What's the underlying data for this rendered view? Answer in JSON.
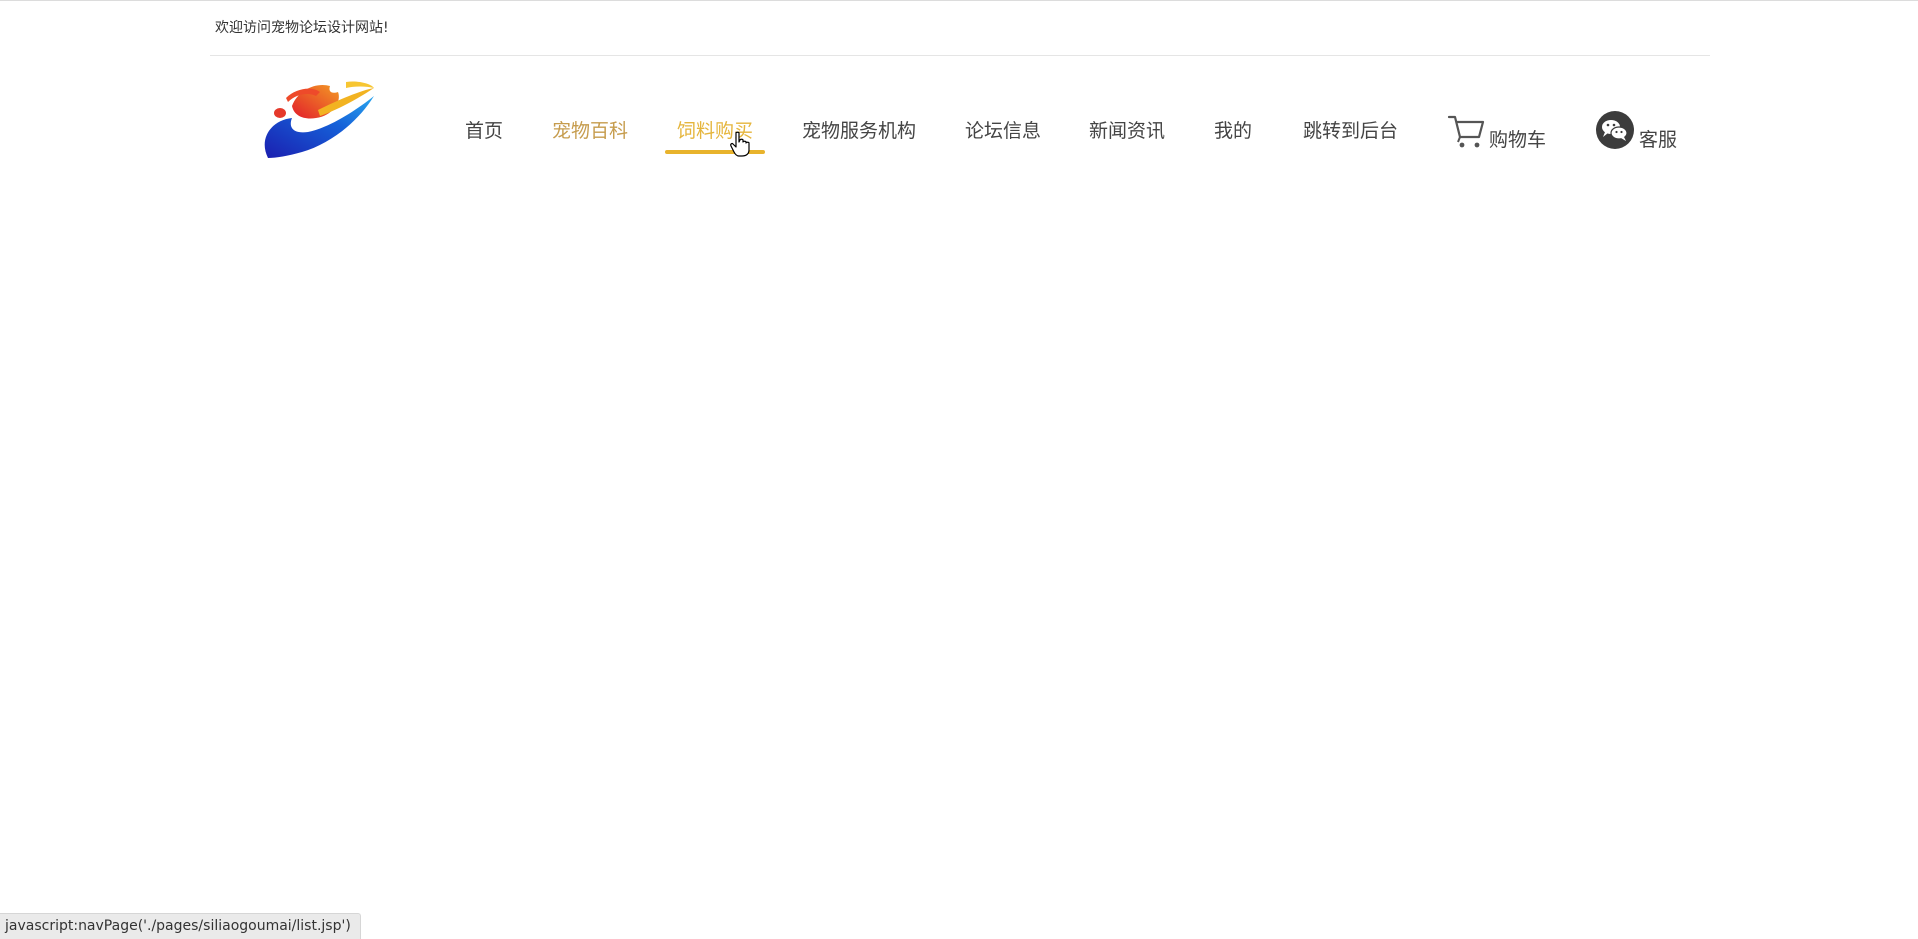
{
  "header": {
    "welcome_text": "欢迎访问宠物论坛设计网站!"
  },
  "logo": {
    "icon": "swoosh-logo-icon"
  },
  "nav": {
    "items": [
      {
        "label": "首页"
      },
      {
        "label": "宠物百科"
      },
      {
        "label": "饲料购买",
        "active": true
      },
      {
        "label": "宠物服务机构"
      },
      {
        "label": "论坛信息"
      },
      {
        "label": "新闻资讯"
      },
      {
        "label": "我的"
      },
      {
        "label": "跳转到后台"
      }
    ],
    "cart": {
      "label": "购物车",
      "icon": "shopping-cart-icon"
    },
    "service": {
      "label": "客服",
      "icon": "wechat-icon"
    }
  },
  "colors": {
    "active": "#e5b53c",
    "hover_gold": "#c69c4d",
    "underline": "#e8b32c",
    "text": "#444444"
  },
  "status_bar": {
    "text": "javascript:navPage('./pages/siliaogoumai/list.jsp')"
  }
}
